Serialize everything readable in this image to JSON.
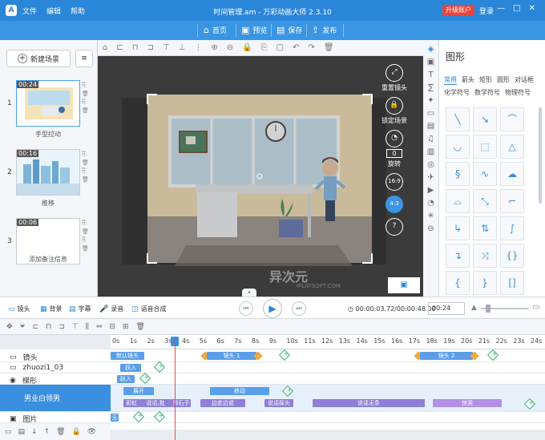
{
  "menu": [
    "文件",
    "编辑",
    "帮助"
  ],
  "window_title": "时间管理.am - 万彩动画大师 2.3.10",
  "upgrade": "升级账户",
  "login": "登录",
  "toolbar": {
    "home": "首页",
    "preview": "预览",
    "save": "保存",
    "publish": "发布"
  },
  "scenes": {
    "new": "新建场景",
    "items": [
      {
        "num": "1",
        "dur": "00:24",
        "label": "手型拉动"
      },
      {
        "num": "2",
        "dur": "00:16",
        "label": "推移"
      },
      {
        "num": "3",
        "dur": "00:06",
        "label": "添加备注信息"
      }
    ]
  },
  "canvas_controls": {
    "reset": "重置镜头",
    "lock": "锁定场景",
    "rotate": "旋转",
    "rotate_value": "0",
    "ratio": "16:9",
    "ratio2": "4:3",
    "help": "?"
  },
  "watermark": "异次元",
  "watermark_url": "IPLAYSOFT.COM",
  "shapes": {
    "title": "图形",
    "tabs": [
      "常用",
      "箭头",
      "矩形",
      "圆形",
      "对话框"
    ],
    "tabs2": [
      "化学符号",
      "数学符号",
      "物理符号"
    ]
  },
  "timeline": {
    "tools": {
      "camera": "镜头",
      "background": "背景",
      "subtitle": "字幕",
      "record": "录音",
      "tts": "语音合成"
    },
    "time": "00:00:03.72/00:00:48.00",
    "duration": "00:24",
    "ticks": [
      "0s",
      "1s",
      "2s",
      "3s",
      "4s",
      "5s",
      "6s",
      "7s",
      "8s",
      "9s",
      "10s",
      "11s",
      "12s",
      "13s",
      "14s",
      "15s",
      "16s",
      "17s",
      "18s",
      "19s",
      "20s",
      "21s",
      "22s",
      "23s",
      "24s"
    ],
    "tracks": [
      {
        "name": "镜头",
        "bars": [
          "默认镜头",
          "镜头 1",
          "镜头 2"
        ]
      },
      {
        "name": "zhuozi1_03",
        "bars": [
          "跃入"
        ]
      },
      {
        "name": "梯形",
        "bars": [
          "跃入"
        ]
      },
      {
        "name": "男业白领男",
        "bars": [
          "展开",
          "移动",
          "彩虹",
          "说话,批",
          "滑石子",
          "边走边说",
          "说话挥头",
          "说话无条",
          "惊哭"
        ]
      },
      {
        "name": "图片",
        "bars": [
          "无"
        ]
      }
    ]
  }
}
